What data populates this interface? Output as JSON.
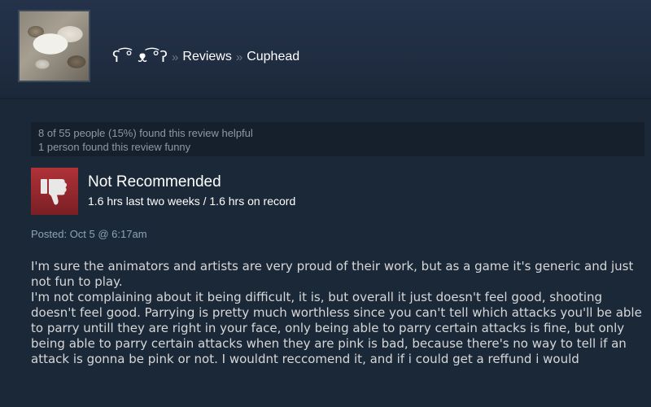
{
  "header": {
    "username": "ʕ ͡° ᴥ ͡°ʔ",
    "separator": "»",
    "crumb_reviews": "Reviews",
    "crumb_game": "Cuphead"
  },
  "helpful": {
    "line1": "8 of 55 people (15%) found this review helpful",
    "line2": "1 person found this review funny"
  },
  "verdict": {
    "title": "Not Recommended",
    "hours": "1.6 hrs last two weeks / 1.6 hrs on record",
    "icon": "thumbs-down-icon",
    "icon_color": "#b03239"
  },
  "posted": "Posted: Oct 5 @ 6:17am",
  "review": {
    "p1": "I'm sure the animators and artists are very proud of their work, but as a game it's generic and just not fun to play.",
    "p2": "I'm not complaining about it being difficult, it is, but overall it just doesn't feel good, shooting doesn't feel good. Parrying is pretty much worthless since you can't tell which attacks you'll be able to parry untill they are right in your face, only being able to parry certain attacks is fine, but only being able to parry certain attacks when they are pink is bad, because there's no way to tell if an attack is gonna be pink or not. I wouldnt reccomend it, and if i could get a reffund i would"
  }
}
